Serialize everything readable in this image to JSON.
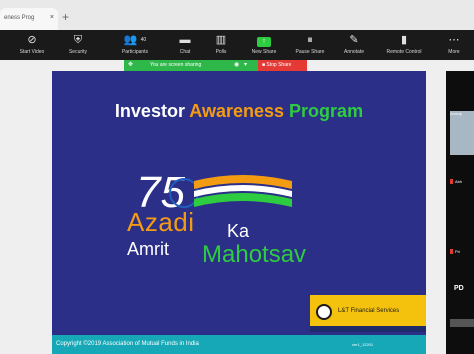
{
  "browser": {
    "tab_title": "eness Prog",
    "tab_close": "×",
    "new_tab": "+"
  },
  "toolbar": {
    "items": [
      {
        "label": "Start Video",
        "icon": "video-off-icon",
        "glyph": "⊘"
      },
      {
        "label": "Security",
        "icon": "shield-icon",
        "glyph": "⛨"
      },
      {
        "label": "Participants",
        "icon": "participants-icon",
        "glyph": "👥",
        "count": "40"
      },
      {
        "label": "Chat",
        "icon": "chat-icon",
        "glyph": "▬"
      },
      {
        "label": "Polls",
        "icon": "polls-icon",
        "glyph": "▥"
      },
      {
        "label": "New Share",
        "icon": "new-share-icon",
        "glyph": "↑"
      },
      {
        "label": "Pause Share",
        "icon": "pause-icon",
        "glyph": "⏸"
      },
      {
        "label": "Annotate",
        "icon": "pencil-icon",
        "glyph": "✎"
      },
      {
        "label": "Remote Control",
        "icon": "remote-control-icon",
        "glyph": "▮"
      },
      {
        "label": "More",
        "icon": "more-icon",
        "glyph": "⋯"
      }
    ]
  },
  "sharing_banner": {
    "text": "You are screen sharing",
    "stop_label": "Stop Share",
    "colors": {
      "active": "#2fb84a",
      "stop": "#e53935"
    }
  },
  "slide": {
    "title_part1": "Investor",
    "title_part2": "Awareness",
    "title_part3": "Program",
    "logo_number": "75",
    "logo_line1": "Azadi",
    "logo_line1b": "Ka",
    "logo_line2": "Amrit",
    "logo_line2b": "Mahotsav",
    "sponsor": "L&T Financial Services",
    "copyright": "Copyright ©2019 Association of Mutual Funds in India",
    "slide_code": "ver1_12201",
    "colors": {
      "background": "#2b2f88",
      "orange": "#f39c12",
      "green": "#2ecc40",
      "footer": "#16a8b6"
    }
  },
  "participants_strip": {
    "name1": "Anuraj",
    "name2": "Abh",
    "name3": "Pri",
    "label_pd": "PD"
  }
}
